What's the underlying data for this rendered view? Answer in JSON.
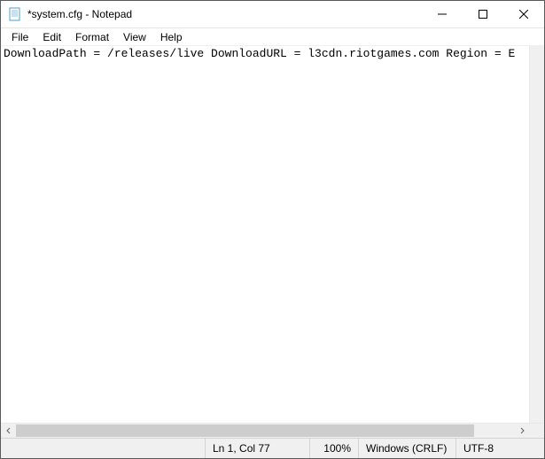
{
  "window": {
    "title": "*system.cfg - Notepad"
  },
  "menu": {
    "file": "File",
    "edit": "Edit",
    "format": "Format",
    "view": "View",
    "help": "Help"
  },
  "editor": {
    "content": "DownloadPath = /releases/live DownloadURL = l3cdn.riotgames.com Region = E"
  },
  "status": {
    "position": "Ln 1, Col 77",
    "zoom": "100%",
    "eol": "Windows (CRLF)",
    "encoding": "UTF-8"
  }
}
